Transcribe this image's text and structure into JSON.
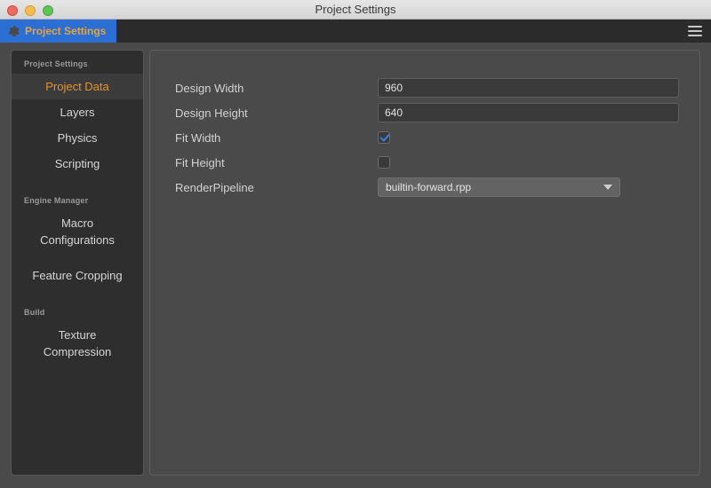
{
  "window": {
    "title": "Project Settings",
    "traffic_lights": [
      "close-button",
      "minimize-button",
      "maximize-button"
    ]
  },
  "tabbar": {
    "active_tab": {
      "label": "Project Settings",
      "icon": "gear-icon",
      "background_color": "#2b6fd4",
      "text_color": "#e8a33d"
    },
    "menu_icon": "hamburger-icon"
  },
  "sidebar": {
    "groups": [
      {
        "header": "Project Settings",
        "items": [
          {
            "label": "Project Data",
            "selected": true
          },
          {
            "label": "Layers",
            "selected": false
          },
          {
            "label": "Physics",
            "selected": false
          },
          {
            "label": "Scripting",
            "selected": false
          }
        ]
      },
      {
        "header": "Engine Manager",
        "items": [
          {
            "label": "Macro Configurations",
            "selected": false
          },
          {
            "label": "Feature Cropping",
            "selected": false
          }
        ]
      },
      {
        "header": "Build",
        "items": [
          {
            "label": "Texture Compression",
            "selected": false
          }
        ]
      }
    ],
    "selected_color": "#e8912d"
  },
  "main": {
    "fields": [
      {
        "label": "Design Width",
        "type": "text",
        "value": "960"
      },
      {
        "label": "Design Height",
        "type": "text",
        "value": "640"
      },
      {
        "label": "Fit Width",
        "type": "checkbox",
        "checked": true
      },
      {
        "label": "Fit Height",
        "type": "checkbox",
        "checked": false
      },
      {
        "label": "RenderPipeline",
        "type": "select",
        "value": "builtin-forward.rpp"
      }
    ]
  }
}
